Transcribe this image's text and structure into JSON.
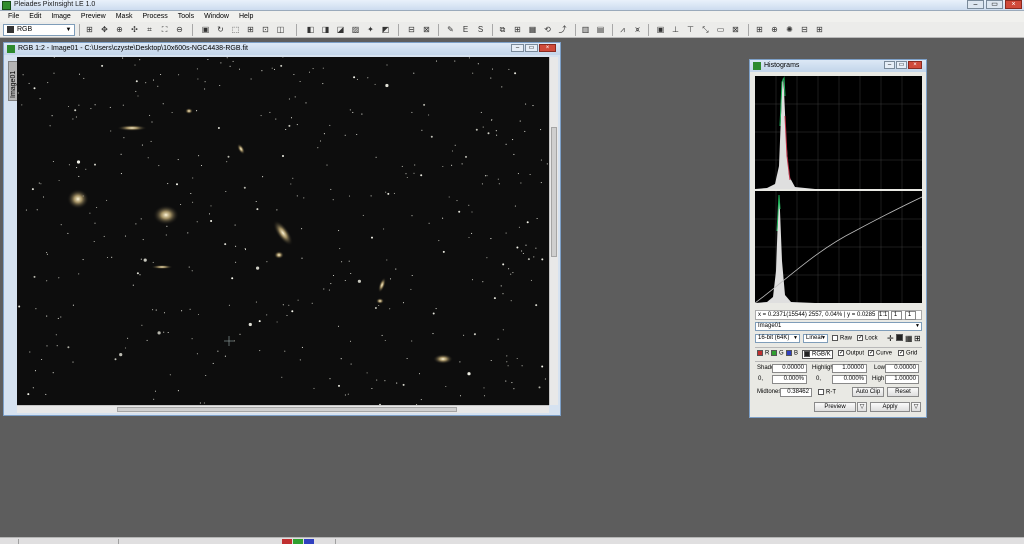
{
  "app": {
    "title": "Pleiades PixInsight LE 1.0",
    "window_buttons": [
      "–",
      "▭",
      "×"
    ]
  },
  "menu": [
    "File",
    "Edit",
    "Image",
    "Preview",
    "Mask",
    "Process",
    "Tools",
    "Window",
    "Help"
  ],
  "toolbar": {
    "color_space_value": "RGB",
    "tool_icons": [
      "new-image-icon",
      "move-icon",
      "zoom-icon",
      "pan-icon",
      "crop-icon",
      "rotate-icon",
      "histogram-icon",
      "curves-icon",
      "preview-icon",
      "mask-icon",
      "star-icon",
      "settings-icon"
    ]
  },
  "image_window": {
    "title": "RGB 1:2 - Image01 - C:\\Users\\czyste\\Desktop\\10x600s-NGC4438-RGB.fit",
    "tab_label": "Image01",
    "scrollbar_center_glyph": "≡"
  },
  "histogram_window": {
    "title": "Histograms",
    "readout": "x = 0.2371(15544)  2557, 0.04%  | y = 0.0285",
    "zoom_h": "1:1",
    "zoom_a": "1",
    "zoom_b": "1",
    "view_select": "Image01",
    "bit_depth": "16-bit (64K)",
    "scale": "Linear",
    "raw_label": "Raw",
    "lock_label": "Lock",
    "ch_r": "R",
    "ch_g": "G",
    "ch_b": "B",
    "ch_rgbk": "RGB/K",
    "output_label": "Output",
    "curve_label": "Curve",
    "grid_label": "Grid",
    "shadows_label": "Shadows",
    "shadows_value": "0.00000",
    "shadows_px": "0,",
    "shadows_pct": "0.000%",
    "highlights_label": "Highlights",
    "highlights_value": "1.00000",
    "highlights_px": "0,",
    "highlights_pct": "0.000%",
    "low_label": "Low",
    "low_value": "0.00000",
    "high_label": "High",
    "high_value": "1.00000",
    "midtones_label": "Midtones",
    "midtones_value": "0.38462",
    "rt_label": "R-T",
    "auto_clip": "Auto Clip",
    "reset": "Reset",
    "preview": "Preview",
    "apply": "Apply"
  },
  "colors": {
    "desktop": "#5d5d5d",
    "title_gradient_top": "#dce8f6",
    "accent_green": "#2e8b2e"
  }
}
